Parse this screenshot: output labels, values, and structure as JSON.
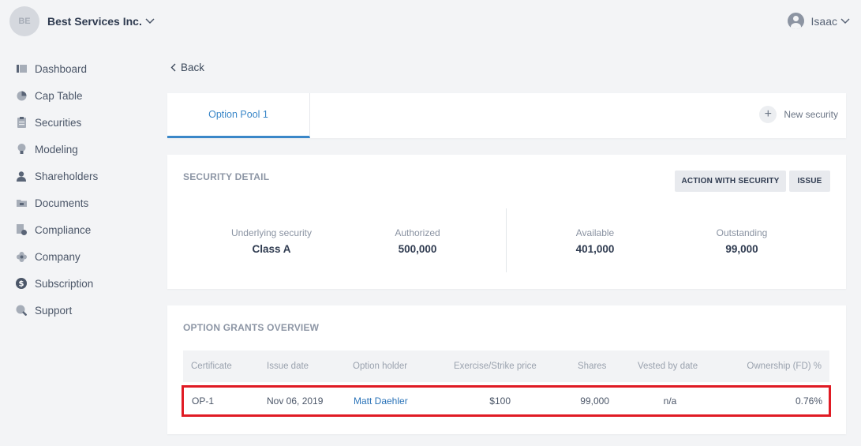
{
  "company": {
    "initials": "BE",
    "name": "Best Services Inc."
  },
  "user": {
    "name": "Isaac"
  },
  "sidebar": {
    "items": [
      {
        "label": "Dashboard",
        "icon": "dashboard-icon"
      },
      {
        "label": "Cap Table",
        "icon": "pie-chart-icon"
      },
      {
        "label": "Securities",
        "icon": "clipboard-icon"
      },
      {
        "label": "Modeling",
        "icon": "lightbulb-icon"
      },
      {
        "label": "Shareholders",
        "icon": "person-icon"
      },
      {
        "label": "Documents",
        "icon": "folder-icon"
      },
      {
        "label": "Compliance",
        "icon": "document-check-icon"
      },
      {
        "label": "Company",
        "icon": "flower-icon"
      },
      {
        "label": "Subscription",
        "icon": "dollar-circle-icon"
      },
      {
        "label": "Support",
        "icon": "support-search-icon"
      }
    ]
  },
  "back_label": "Back",
  "tabs": [
    {
      "label": "Option Pool 1",
      "active": true
    }
  ],
  "new_security_label": "New security",
  "security_detail": {
    "title": "SECURITY DETAIL",
    "action_button": "ACTION WITH SECURITY",
    "issue_button": "ISSUE",
    "stats": [
      {
        "label": "Underlying security",
        "value": "Class A"
      },
      {
        "label": "Authorized",
        "value": "500,000"
      },
      {
        "label": "Available",
        "value": "401,000"
      },
      {
        "label": "Outstanding",
        "value": "99,000"
      }
    ]
  },
  "grants": {
    "title": "OPTION GRANTS OVERVIEW",
    "columns": [
      "Certificate",
      "Issue date",
      "Option holder",
      "Exercise/Strike price",
      "Shares",
      "Vested by date",
      "Ownership (FD) %"
    ],
    "rows": [
      {
        "certificate": "OP-1",
        "issue_date": "Nov 06, 2019",
        "holder": "Matt Daehler",
        "price": "$100",
        "shares": "99,000",
        "vested": "n/a",
        "ownership": "0.76%"
      }
    ]
  },
  "colors": {
    "accent": "#3a87c8",
    "highlight": "#e01b24",
    "link": "#2a73b8"
  }
}
